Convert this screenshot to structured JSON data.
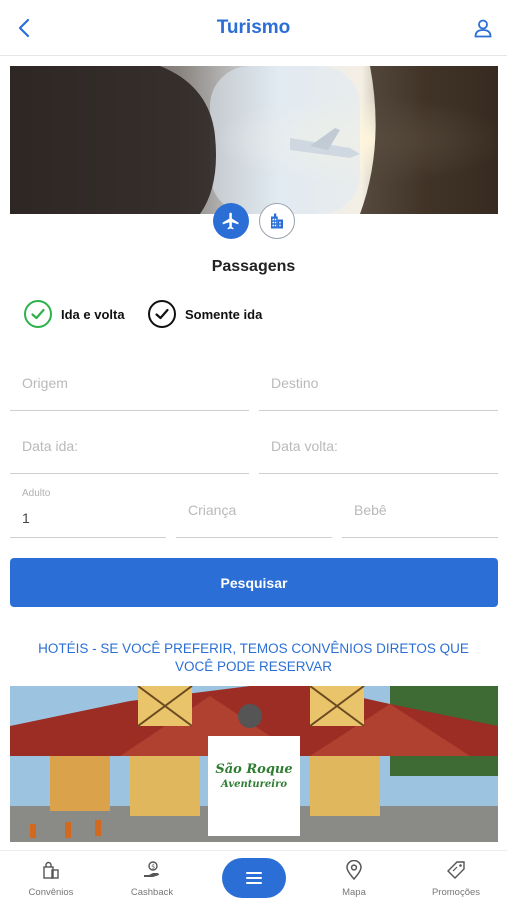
{
  "header": {
    "title": "Turismo",
    "back_icon": "chevron-left-icon",
    "user_icon": "user-icon"
  },
  "section": {
    "title": "Passagens"
  },
  "trip_type": {
    "round_trip_label": "Ida e volta",
    "one_way_label": "Somente ida",
    "round_trip_color": "#2db24a",
    "one_way_color": "#111111"
  },
  "form": {
    "origin_placeholder": "Origem",
    "destination_placeholder": "Destino",
    "date_out_placeholder": "Data ida:",
    "date_return_placeholder": "Data volta:",
    "adult_label": "Adulto",
    "adult_value": "1",
    "child_placeholder": "Criança",
    "baby_placeholder": "Bebê"
  },
  "search_button_label": "Pesquisar",
  "hotels_text": "HOTÉIS - SE VOCÊ PREFERIR, TEMOS CONVÊNIOS DIRETOS QUE VOCÊ PODE RESERVAR",
  "banner": {
    "logo_line1": "São Roque",
    "logo_line2": "Aventureiro"
  },
  "bottom_nav": {
    "items": [
      {
        "label": "Convênios",
        "icon": "shopping-bags-icon"
      },
      {
        "label": "Cashback",
        "icon": "hand-money-icon"
      },
      {
        "label": "Mapa",
        "icon": "map-pin-icon"
      },
      {
        "label": "Promoções",
        "icon": "tag-icon"
      }
    ],
    "menu_icon": "menu-icon"
  },
  "colors": {
    "accent": "#2b6fd6",
    "success": "#2db24a"
  }
}
